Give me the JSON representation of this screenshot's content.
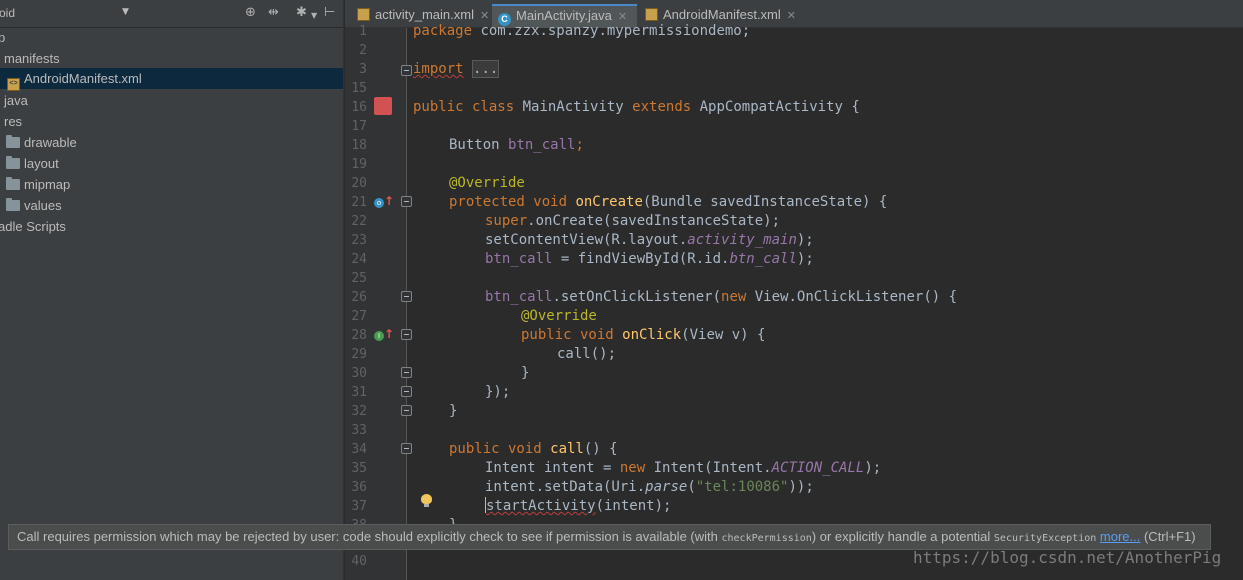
{
  "project_panel": {
    "title": "oid",
    "tree": [
      {
        "label": "p",
        "type": "root"
      },
      {
        "label": "manifests",
        "type": "folder-plain"
      },
      {
        "label": "AndroidManifest.xml",
        "type": "xml",
        "selected": true
      },
      {
        "label": "java",
        "type": "folder-plain"
      },
      {
        "label": "res",
        "type": "folder-plain"
      },
      {
        "label": "drawable",
        "type": "folder"
      },
      {
        "label": "layout",
        "type": "folder"
      },
      {
        "label": "mipmap",
        "type": "folder"
      },
      {
        "label": "values",
        "type": "folder"
      },
      {
        "label": "adle Scripts",
        "type": "folder-plain"
      }
    ]
  },
  "tabs": [
    {
      "label": "activity_main.xml",
      "icon": "xml-file-icon",
      "active": false
    },
    {
      "label": "MainActivity.java",
      "icon": "java-class-icon",
      "active": true
    },
    {
      "label": "AndroidManifest.xml",
      "icon": "xml-file-icon",
      "active": false
    }
  ],
  "gutter": {
    "line_numbers": [
      "1",
      "2",
      "3",
      "15",
      "16",
      "17",
      "18",
      "19",
      "20",
      "21",
      "22",
      "23",
      "24",
      "25",
      "26",
      "27",
      "28",
      "29",
      "30",
      "31",
      "32",
      "33",
      "34",
      "35",
      "36",
      "37",
      "38",
      "40"
    ]
  },
  "code": {
    "l1": {
      "kw": "package",
      "rest": " com.zzx.spanzy.mypermissiondemo;"
    },
    "l3": {
      "import_text": "import",
      "dots": "..."
    },
    "l16": {
      "a": "public class",
      "b": " MainActivity ",
      "c": "extends",
      "d": " AppCompatActivity {"
    },
    "l18": {
      "a": "Button ",
      "b": "btn_call",
      "c": ";"
    },
    "l20": {
      "a": "@Override"
    },
    "l21": {
      "a": "protected void",
      "b": " onCreate",
      "c": "(Bundle savedInstanceState) {"
    },
    "l22": {
      "a": "super",
      "b": ".onCreate(savedInstanceState);"
    },
    "l23": {
      "a": "setContentView(R.layout.",
      "b": "activity_main",
      "c": ");"
    },
    "l24": {
      "a": "btn_call",
      "b": " = findViewById(R.id.",
      "c": "btn_call",
      "d": ");"
    },
    "l26": {
      "a": "btn_call",
      "b": ".setOnClickListener(",
      "c": "new",
      "d": " View.OnClickListener() {"
    },
    "l27": {
      "a": "@Override"
    },
    "l28": {
      "a": "public void",
      "b": " onClick",
      "c": "(View v) {"
    },
    "l29": {
      "a": "call();"
    },
    "l30": {
      "a": "}"
    },
    "l31": {
      "a": "});"
    },
    "l32": {
      "a": "}"
    },
    "l34": {
      "a": "public void",
      "b": " call",
      "c": "() {"
    },
    "l35": {
      "a": "Intent intent = ",
      "b": "new",
      "c": " Intent(Intent.",
      "d": "ACTION_CALL",
      "e": ");"
    },
    "l36": {
      "a": "intent.setData(Uri.",
      "b": "parse",
      "c": "(",
      "d": "\"tel:10086\"",
      "e": "));"
    },
    "l37": {
      "a": "startActivity",
      "b": "(intent);"
    },
    "l38": {
      "a": "}"
    }
  },
  "tooltip": {
    "text_1": "Call requires permission which may be rejected by user: code should explicitly check to see if permission is available (with ",
    "mono_1": "checkPermission",
    "text_2": ") or explicitly handle a potential ",
    "mono_2": "SecurityException",
    "link": "more...",
    "shortcut": " (Ctrl+F1)"
  },
  "watermark": "https://blog.csdn.net/AnotherPig"
}
